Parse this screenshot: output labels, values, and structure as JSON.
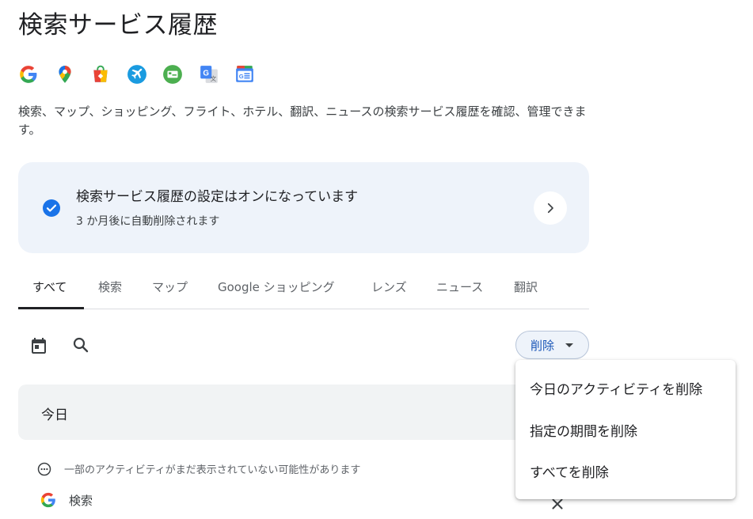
{
  "page": {
    "title": "検索サービス履歴",
    "description": "検索、マップ、ショッピング、フライト、ホテル、翻訳、ニュースの検索サービス履歴を確認、管理できます。"
  },
  "product_icons": [
    "google-icon",
    "maps-icon",
    "shopping-icon",
    "flights-icon",
    "hotels-icon",
    "translate-icon",
    "news-icon"
  ],
  "setting": {
    "title": "検索サービス履歴の設定はオンになっています",
    "subtitle": "3 か月後に自動削除されます"
  },
  "tabs": [
    {
      "label": "すべて",
      "active": true
    },
    {
      "label": "検索"
    },
    {
      "label": "マップ"
    },
    {
      "label": "Google ショッピング"
    },
    {
      "label": "レンズ"
    },
    {
      "label": "ニュース"
    },
    {
      "label": "翻訳"
    }
  ],
  "toolbar": {
    "delete_label": "削除"
  },
  "today": {
    "label": "今日"
  },
  "notice": {
    "text": "一部のアクティビティがまだ表示されていない可能性があります"
  },
  "activity": {
    "label": "検索"
  },
  "delete_menu": {
    "items": [
      "今日のアクティビティを削除",
      "指定の期間を削除",
      "すべてを削除"
    ]
  },
  "colors": {
    "accent": "#1a73e8",
    "card_bg": "#eef3fa"
  }
}
